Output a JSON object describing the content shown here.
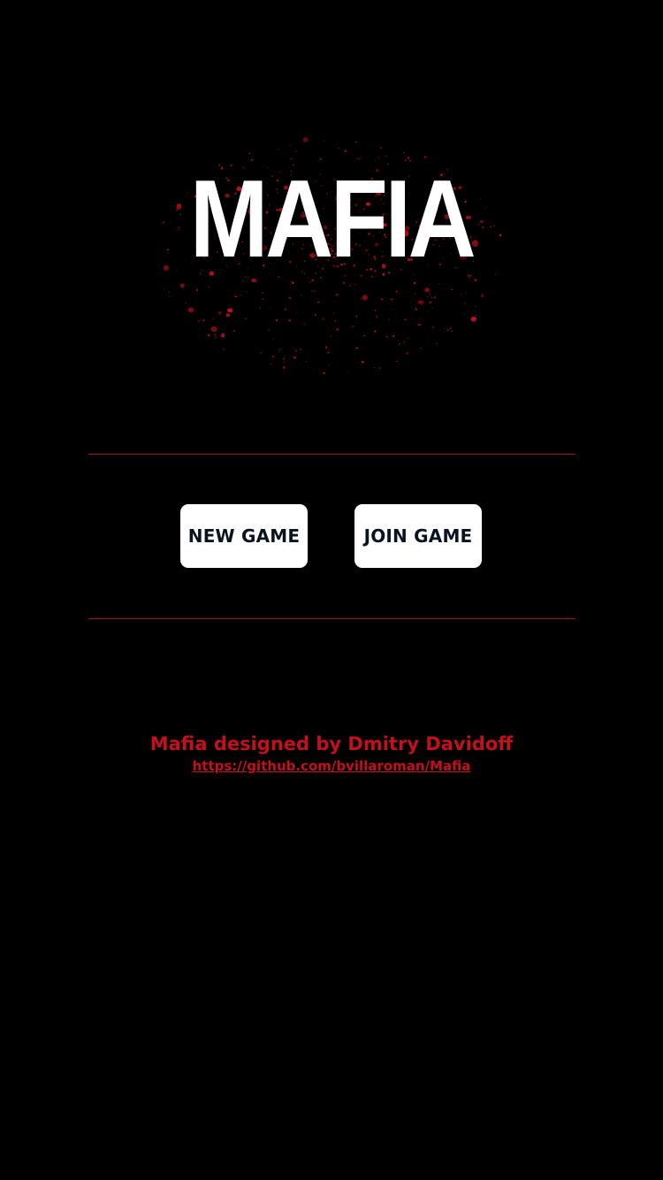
{
  "logo": {
    "title": "MAFIA",
    "splatter_color": "#c4101d"
  },
  "actions": {
    "new_game_label": "NEW GAME",
    "join_game_label": "JOIN GAME"
  },
  "credits": {
    "designer_line": "Mafia designed by Dmitry Davidoff",
    "repo_link": "https://github.com/bvillaroman/Mafia"
  },
  "colors": {
    "background": "#000000",
    "accent": "#c4101d",
    "divider": "#a3151b",
    "button_bg": "#ffffff",
    "button_text": "#0b1220"
  }
}
